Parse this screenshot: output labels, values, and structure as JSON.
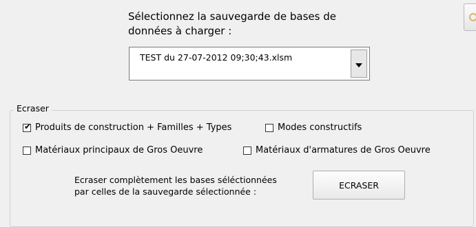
{
  "prompt": {
    "line1": "Sélectionnez la sauvegarde de bases de",
    "line2": "données à charger :"
  },
  "backup_select": {
    "value": "TEST du 27-07-2012 09;30;43.xlsm"
  },
  "erase_group": {
    "legend": "Ecraser",
    "checkboxes": [
      {
        "label": "Produits de construction + Familles + Types",
        "checked": true
      },
      {
        "label": "Modes constructifs",
        "checked": false
      },
      {
        "label": "Matériaux principaux de Gros Oeuvre",
        "checked": false
      },
      {
        "label": "Matériaux d'armatures de Gros Oeuvre",
        "checked": false
      }
    ],
    "description": {
      "line1": "Ecraser complètement les bases séléctionnées",
      "line2": "par celles de la sauvegarde sélectionnée :"
    },
    "button_label": "ECRASER"
  },
  "icons": {
    "check_glyph": "✔"
  }
}
